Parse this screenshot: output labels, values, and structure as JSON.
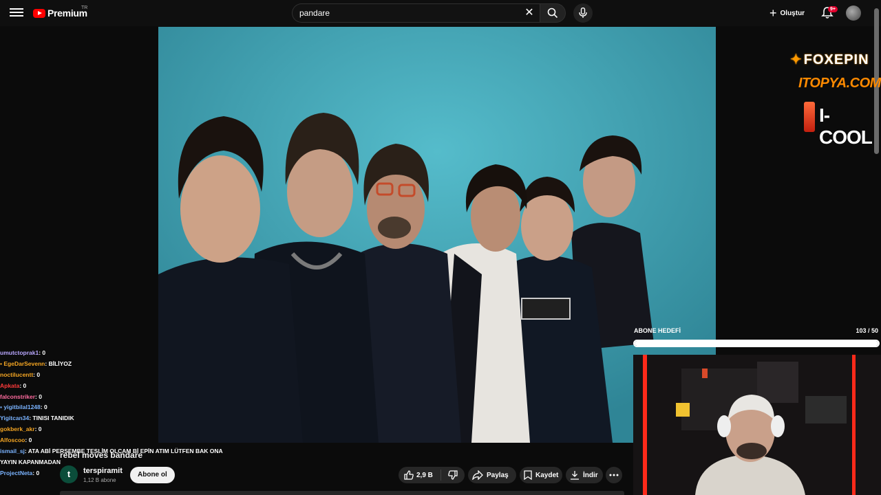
{
  "header": {
    "brand": "Premium",
    "country": "TR",
    "search_value": "pandare",
    "create_label": "Oluştur",
    "notification_badge": "9+"
  },
  "video": {
    "title": "rebel moves bandare"
  },
  "channel": {
    "avatar_letter": "t",
    "name": "terspiramit",
    "subscribers": "1,12 B abone",
    "subscribe_label": "Abone ol"
  },
  "actions": {
    "likes": "2,9 B",
    "share_label": "Paylaş",
    "save_label": "Kaydet",
    "download_label": "İndir"
  },
  "overlay": {
    "sponsor_1": "FOXEPIN",
    "sponsor_2": "ITOPYA.COM",
    "sponsor_3": "I-COOL",
    "goal_title": "ABONE HEDEFİ",
    "goal_count": "103 / 50",
    "goal_progress": 1.0
  },
  "chat": [
    {
      "name": "umutctoprak1",
      "msg": ": 0",
      "color": "#b9a7ff"
    },
    {
      "name": "EgeDarSevenn",
      "msg": ": BİLİYOZ",
      "color": "#f5a623",
      "icon": true
    },
    {
      "name": "noctilucentt",
      "msg": ": 0",
      "color": "#f5a623"
    },
    {
      "name": "Apkata",
      "msg": ": 0",
      "color": "#ff3b3b"
    },
    {
      "name": "falconstriker",
      "msg": ": 0",
      "color": "#ff6b9e"
    },
    {
      "name": "yigitbilal1248",
      "msg": ": 0",
      "color": "#7ab3ff",
      "icon": true
    },
    {
      "name": "Yigitcan34",
      "msg": ": TINISI TANIDIK",
      "color": "#7ab3ff"
    },
    {
      "name": "gokberk_akr",
      "msg": ": 0",
      "color": "#f5a623"
    },
    {
      "name": "Alfoscoo",
      "msg": ": 0",
      "color": "#f5a623"
    },
    {
      "name": "ismail_sj",
      "msg": ": ATA ABİ PERŞEMBE TESLİM OLCAM Bİ EPİN ATIM LÜTFEN BAK ONA",
      "color": "#7ab3ff"
    },
    {
      "name": "",
      "msg": "YAYIN KAPANMADAN",
      "color": "#ffffff"
    },
    {
      "name": "ProjectNeta",
      "msg": ": 0",
      "color": "#7ab3ff"
    }
  ]
}
